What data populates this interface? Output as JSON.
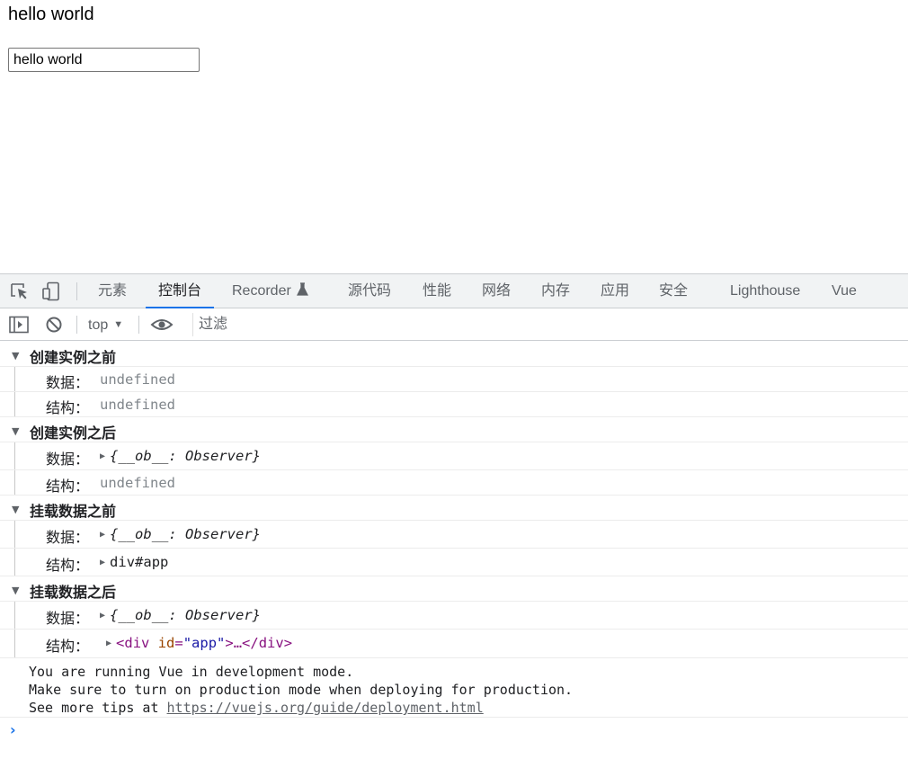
{
  "page": {
    "heading": "hello world",
    "input_value": "hello world"
  },
  "devtools": {
    "tabs": [
      {
        "label": "元素"
      },
      {
        "label": "控制台"
      },
      {
        "label": "Recorder"
      },
      {
        "label": "源代码"
      },
      {
        "label": "性能"
      },
      {
        "label": "网络"
      },
      {
        "label": "内存"
      },
      {
        "label": "应用"
      },
      {
        "label": "安全"
      },
      {
        "label": "Lighthouse"
      },
      {
        "label": "Vue"
      }
    ],
    "active_tab": "控制台",
    "toolbar": {
      "context": "top",
      "filter_placeholder": "过滤"
    },
    "icons": {
      "inspect": "inspect-element-icon",
      "device": "device-toolbar-icon",
      "sidebar": "show-sidebar-icon",
      "clear": "clear-console-icon",
      "eye": "live-expression-icon",
      "flask": "experimental-flask-icon"
    },
    "accent_color": "#1a73e8",
    "console": {
      "groups": [
        {
          "title": "创建实例之前",
          "rows": [
            {
              "label": "数据：",
              "value": "undefined"
            },
            {
              "label": "结构：",
              "value": "undefined"
            }
          ]
        },
        {
          "title": "创建实例之后",
          "rows": [
            {
              "label": "数据：",
              "value": "{__ob__: Observer}"
            },
            {
              "label": "结构：",
              "value": "undefined"
            }
          ]
        },
        {
          "title": "挂载数据之前",
          "rows": [
            {
              "label": "数据：",
              "value": "{__ob__: Observer}"
            },
            {
              "label": "结构：",
              "value": "div#app"
            }
          ]
        },
        {
          "title": "挂载数据之后",
          "rows": [
            {
              "label": "数据：",
              "value": "{__ob__: Observer}"
            },
            {
              "label": "结构：",
              "tag_open": "<div",
              "attr_name": "id",
              "attr_eq": "=",
              "attr_value": "\"app\"",
              "tag_rest": ">…</div>"
            }
          ]
        }
      ],
      "message": {
        "line1": "You are running Vue in development mode.",
        "line2": "Make sure to turn on production mode when deploying for production.",
        "line3_prefix": "See more tips at ",
        "link": "https://vuejs.org/guide/deployment.html"
      },
      "prompt": "›"
    }
  }
}
